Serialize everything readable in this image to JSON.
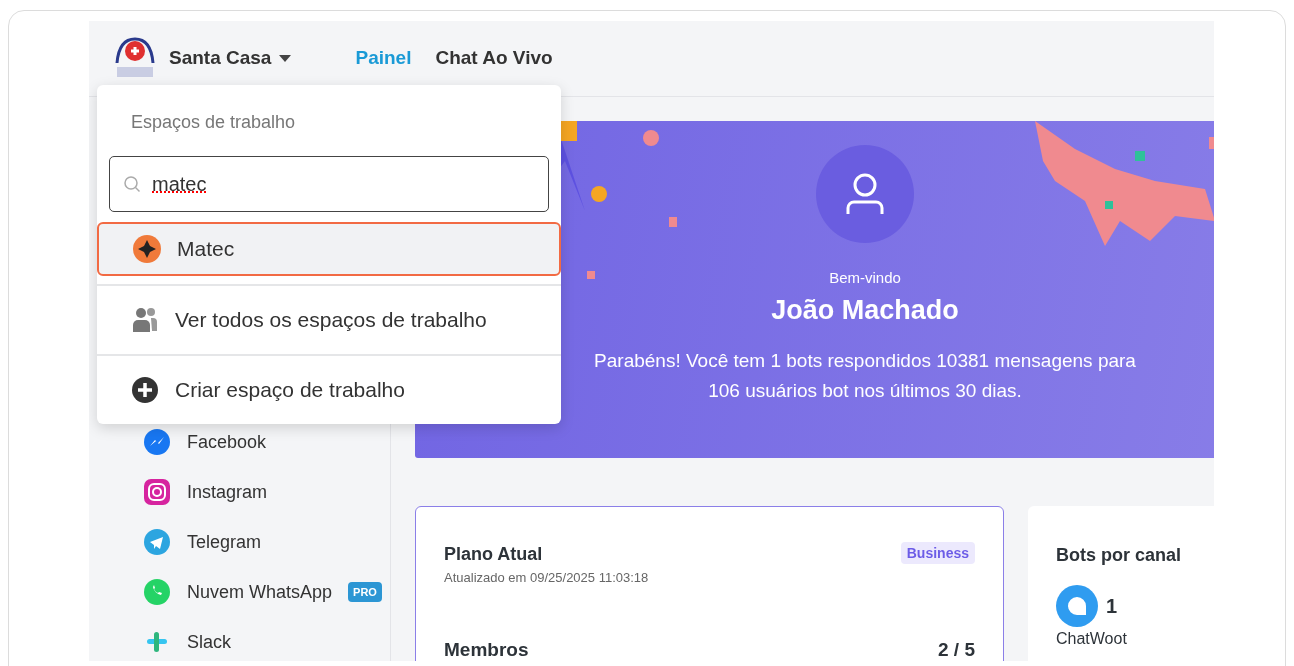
{
  "header": {
    "workspace": "Santa Casa",
    "nav": [
      {
        "label": "Painel",
        "selected": true
      },
      {
        "label": "Chat Ao Vivo",
        "selected": false
      }
    ]
  },
  "workspace_menu": {
    "title": "Espaços de trabalho",
    "search": {
      "value": "matec"
    },
    "results": [
      {
        "label": "Matec",
        "selected": true
      }
    ],
    "actions": [
      {
        "kind": "view_all",
        "label": "Ver todos os espaços de trabalho"
      },
      {
        "kind": "create",
        "label": "Criar espaço de trabalho"
      }
    ]
  },
  "sidebar": {
    "items": [
      {
        "kind": "facebook",
        "label": "Facebook"
      },
      {
        "kind": "instagram",
        "label": "Instagram"
      },
      {
        "kind": "telegram",
        "label": "Telegram"
      },
      {
        "kind": "whatsapp",
        "label": "Nuvem WhatsApp",
        "badge": "PRO"
      },
      {
        "kind": "slack",
        "label": "Slack"
      }
    ]
  },
  "banner": {
    "greeting": "Bem-vindo",
    "name": "João Machado",
    "message": "Parabéns! Você tem 1 bots respondidos 10381 mensagens para 106 usuários bot nos últimos 30 dias."
  },
  "plan_card": {
    "title": "Plano Atual",
    "updated": "Atualizado em 09/25/2025 11:03:18",
    "plan": "Business",
    "members_label": "Membros",
    "members_value": "2 / 5"
  },
  "bots_card": {
    "title": "Bots por canal",
    "channels": [
      {
        "count": "1",
        "label": "ChatWoot"
      }
    ]
  }
}
